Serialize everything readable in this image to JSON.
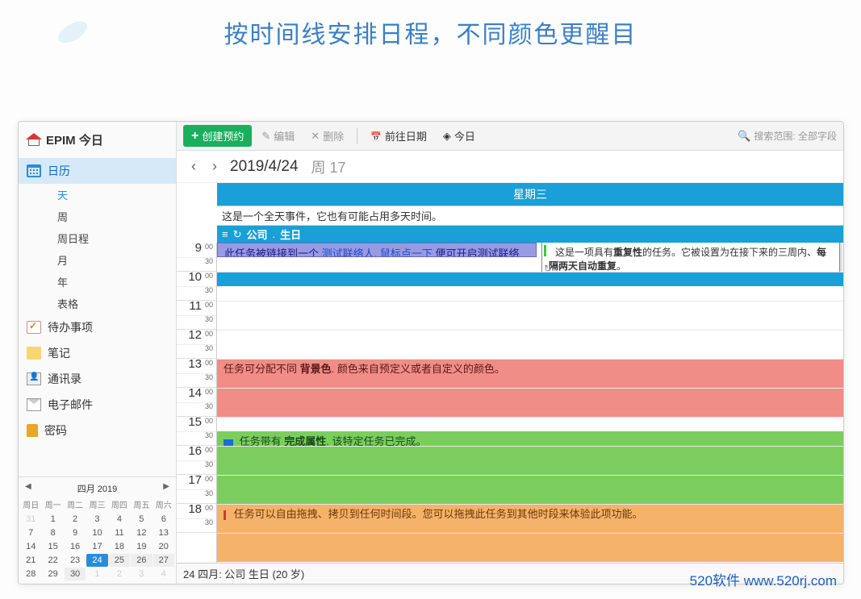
{
  "page_title": "按时间线安排日程，不同颜色更醒目",
  "app_title": "EPIM 今日",
  "nav": {
    "calendar": "日历",
    "views": {
      "day": "天",
      "week": "周",
      "week_agenda": "周日程",
      "month": "月",
      "year": "年",
      "grid": "表格"
    },
    "todo": "待办事项",
    "notes": "笔记",
    "contacts": "通讯录",
    "mail": "电子邮件",
    "password": "密码"
  },
  "toolbar": {
    "new": "创建预约",
    "edit": "编辑",
    "delete": "删除",
    "goto": "前往日期",
    "today": "今日",
    "search_placeholder": "搜索范围: 全部字段"
  },
  "date_nav": {
    "date": "2019/4/24",
    "week": "周 17"
  },
  "day_header": "星期三",
  "allday_text": "这是一个全天事件，它也有可能占用多天时间。",
  "birthday": {
    "company": "公司",
    "label": "生日"
  },
  "events": {
    "e1_prefix": "此任务被链接到一个 ",
    "e1_link1": "测试联络人",
    "e1_mid": ". ",
    "e1_link2": "鼠标点一下",
    "e1_suffix": " 便可开启测试联络人。",
    "tooltip_p1": "这是一项具有",
    "tooltip_bold": "重复性",
    "tooltip_p2": "的任务。它被设置为在接下来的三周内、",
    "tooltip_bold2": "每隔两天自动重复",
    "tooltip_p3": "。",
    "e2_p1": "任务可分配不同 ",
    "e2_bold": "背景色",
    "e2_p2": ". 颜色来自预定义或者自定义的颜色。",
    "e3_p1": "任务带有 ",
    "e3_bold": "完成属性",
    "e3_p2": ". 该特定任务已完成。",
    "e4": "任务可以自由拖拽、拷贝到任何时间段。您可以拖拽此任务到其他时段来体验此项功能。"
  },
  "status_bar": "24 四月: 公司 生日  (20 岁)",
  "mini_cal": {
    "title": "四月   2019",
    "dow": [
      "周日",
      "周一",
      "周二",
      "周三",
      "周四",
      "周五",
      "周六"
    ],
    "rows": [
      [
        "31",
        "1",
        "2",
        "3",
        "4",
        "5",
        "6"
      ],
      [
        "7",
        "8",
        "9",
        "10",
        "11",
        "12",
        "13"
      ],
      [
        "14",
        "15",
        "16",
        "17",
        "18",
        "19",
        "20"
      ],
      [
        "21",
        "22",
        "23",
        "24",
        "25",
        "26",
        "27"
      ],
      [
        "28",
        "29",
        "30",
        "1",
        "2",
        "3",
        "4"
      ]
    ],
    "today": "24",
    "other_month": [
      "31"
    ],
    "next_month": [
      "1",
      "2",
      "3",
      "4"
    ]
  },
  "watermark": "520软件 www.520rj.com",
  "hours": [
    9,
    10,
    11,
    12,
    13,
    14,
    15,
    16,
    17,
    18
  ]
}
